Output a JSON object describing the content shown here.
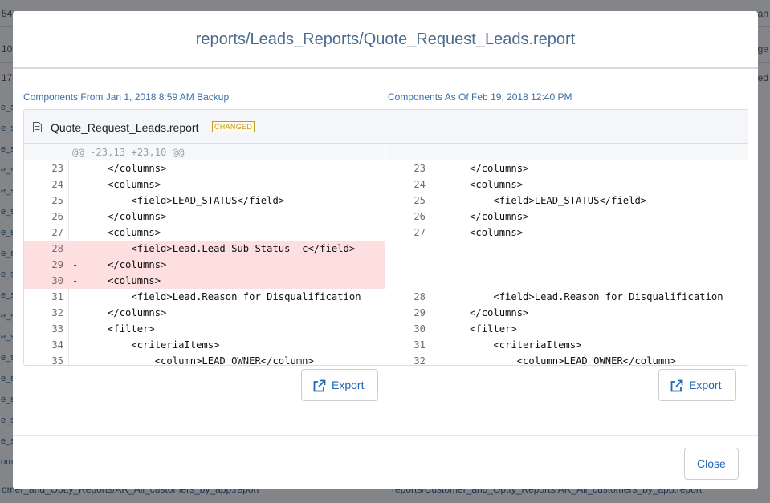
{
  "background": {
    "rows": [
      {
        "left": "54",
        "right": "an"
      },
      {
        "left": "10",
        "right": "nge"
      },
      {
        "left": "17",
        "right": "ted"
      }
    ],
    "sidebar_fragment": "e_s",
    "sidebar_fragment_alt": "ome",
    "bottom_left": "omer_and_Optty_Reports/AR_All_customers_by_app.report",
    "bottom_right": "reports/Customer_and_Optty_Reports/AR_All_customers_by_app.report"
  },
  "modal": {
    "title": "reports/Leads_Reports/Quote_Request_Leads.report",
    "left_label": "Components From Jan 1, 2018 8:59 AM Backup",
    "right_label": "Components As Of Feb 19, 2018 12:40 PM",
    "file_name": "Quote_Request_Leads.report",
    "badge": "CHANGED",
    "hunk_header": "@@ -23,13 +23,10 @@",
    "left_lines": [
      {
        "num": "23",
        "type": "ctx",
        "mark": "",
        "code": "      </columns>"
      },
      {
        "num": "24",
        "type": "ctx",
        "mark": "",
        "code": "      <columns>"
      },
      {
        "num": "25",
        "type": "ctx",
        "mark": "",
        "code": "          <field>LEAD_STATUS</field>"
      },
      {
        "num": "26",
        "type": "ctx",
        "mark": "",
        "code": "      </columns>"
      },
      {
        "num": "27",
        "type": "ctx",
        "mark": "",
        "code": "      <columns>"
      },
      {
        "num": "28",
        "type": "del",
        "mark": "-",
        "code": "          <field>Lead.Lead_Sub_Status__c</field>"
      },
      {
        "num": "29",
        "type": "del",
        "mark": "-",
        "code": "      </columns>"
      },
      {
        "num": "30",
        "type": "del",
        "mark": "-",
        "code": "      <columns>"
      },
      {
        "num": "31",
        "type": "ctx",
        "mark": "",
        "code": "          <field>Lead.Reason_for_Disqualification_"
      },
      {
        "num": "32",
        "type": "ctx",
        "mark": "",
        "code": "      </columns>"
      },
      {
        "num": "33",
        "type": "ctx",
        "mark": "",
        "code": "      <filter>"
      },
      {
        "num": "34",
        "type": "ctx",
        "mark": "",
        "code": "          <criteriaItems>"
      },
      {
        "num": "35",
        "type": "ctx",
        "mark": "",
        "code": "              <column>LEAD_OWNER</column>"
      }
    ],
    "right_lines": [
      {
        "num": "23",
        "type": "ctx",
        "code": "      </columns>"
      },
      {
        "num": "24",
        "type": "ctx",
        "code": "      <columns>"
      },
      {
        "num": "25",
        "type": "ctx",
        "code": "          <field>LEAD_STATUS</field>"
      },
      {
        "num": "26",
        "type": "ctx",
        "code": "      </columns>"
      },
      {
        "num": "27",
        "type": "ctx",
        "code": "      <columns>"
      },
      {
        "num": "",
        "type": "empty",
        "code": ""
      },
      {
        "num": "",
        "type": "empty",
        "code": ""
      },
      {
        "num": "",
        "type": "empty",
        "code": ""
      },
      {
        "num": "28",
        "type": "ctx",
        "code": "          <field>Lead.Reason_for_Disqualification_"
      },
      {
        "num": "29",
        "type": "ctx",
        "code": "      </columns>"
      },
      {
        "num": "30",
        "type": "ctx",
        "code": "      <filter>"
      },
      {
        "num": "31",
        "type": "ctx",
        "code": "          <criteriaItems>"
      },
      {
        "num": "32",
        "type": "ctx",
        "code": "              <column>LEAD_OWNER</column>"
      }
    ],
    "export_label": "Export",
    "close_label": "Close"
  },
  "colors": {
    "accent": "#2067b8",
    "deleted_bg": "#fddfe0",
    "badge": "#c29b25",
    "title": "#4a6c8f"
  }
}
